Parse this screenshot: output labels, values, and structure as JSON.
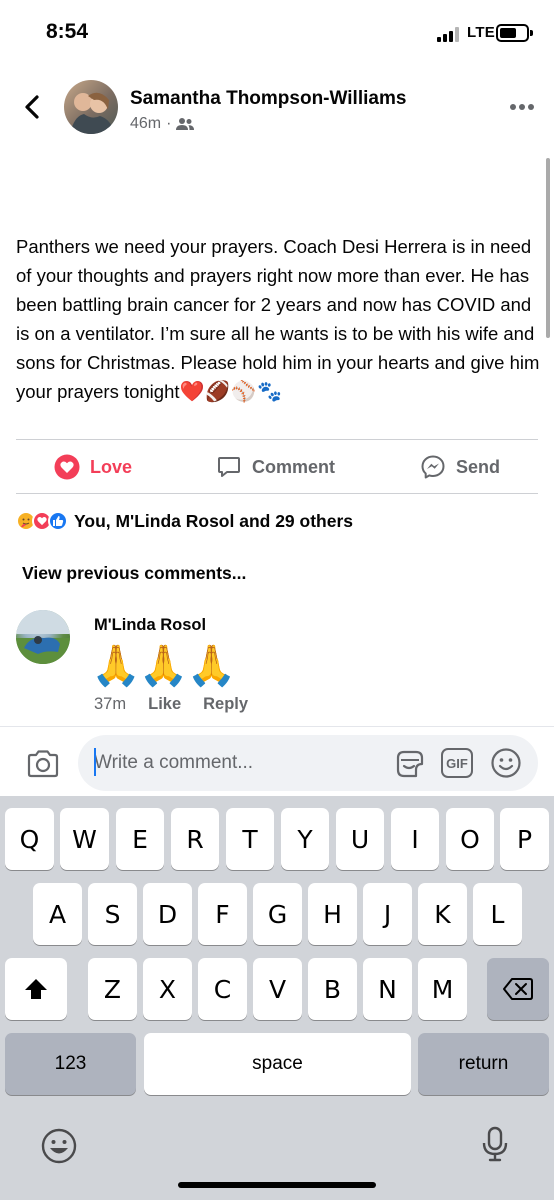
{
  "status_bar": {
    "time": "8:54",
    "network": "LTE"
  },
  "post": {
    "author": "Samantha Thompson-Williams",
    "time_ago": "46m",
    "meta_separator": "·",
    "audience_icon": "friends-icon",
    "text": "Panthers we need your prayers. Coach Desi Herrera is in need of your thoughts and prayers right now more than ever. He has been battling brain cancer for 2 years and now has COVID and is on a ventilator. I’m sure all he wants is to be with his wife and sons for Christmas. Please hold him in your hearts and give him your prayers tonight",
    "text_emoji": "❤️🏈⚾️🐾"
  },
  "actions": {
    "love": "Love",
    "comment": "Comment",
    "send": "Send",
    "love_color": "#f33e58"
  },
  "reactions": {
    "summary": "You, M'Linda Rosol and 29 others",
    "icons": [
      "care-reaction-icon",
      "love-reaction-icon",
      "like-reaction-icon"
    ]
  },
  "comments": {
    "view_previous": "View previous comments...",
    "items": [
      {
        "author": "M'Linda Rosol",
        "content": "🙏🙏🙏",
        "time_ago": "37m",
        "like": "Like",
        "reply": "Reply"
      }
    ]
  },
  "composer": {
    "placeholder": "Write a comment...",
    "gif_label": "GIF"
  },
  "keyboard": {
    "row1": [
      "Q",
      "W",
      "E",
      "R",
      "T",
      "Y",
      "U",
      "I",
      "O",
      "P"
    ],
    "row2": [
      "A",
      "S",
      "D",
      "F",
      "G",
      "H",
      "J",
      "K",
      "L"
    ],
    "row3": [
      "Z",
      "X",
      "C",
      "V",
      "B",
      "N",
      "M"
    ],
    "numbers": "123",
    "space": "space",
    "return": "return"
  }
}
